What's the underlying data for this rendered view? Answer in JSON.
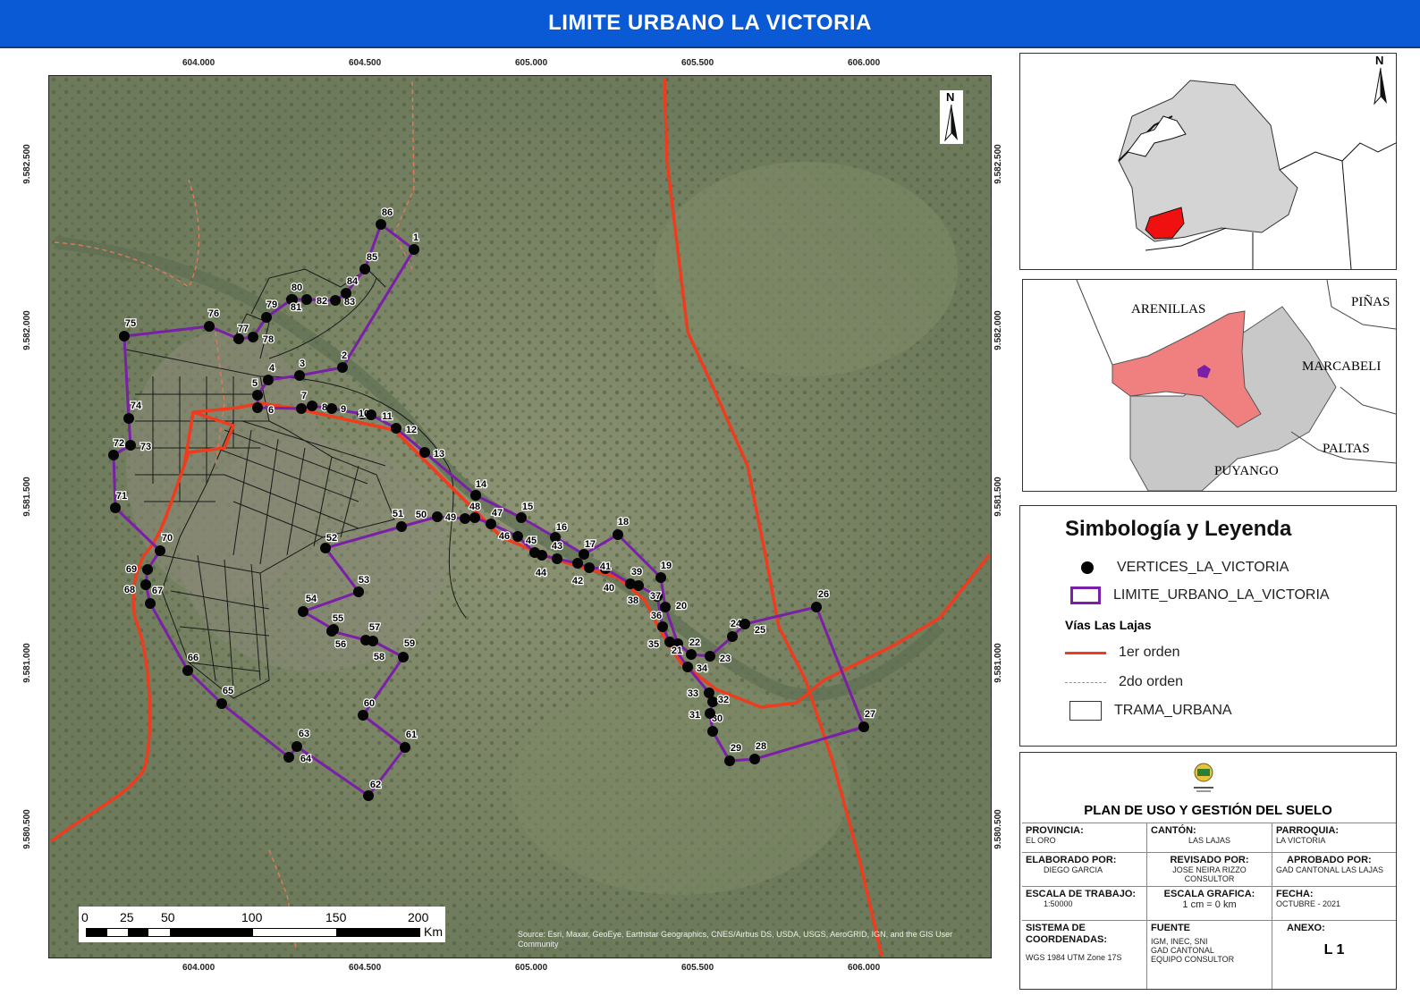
{
  "title": "LIMITE URBANO LA VICTORIA",
  "grid": {
    "x_labels": [
      "604.000",
      "604.500",
      "605.000",
      "605.500",
      "606.000"
    ],
    "y_labels": [
      "9.582.500",
      "9.582.000",
      "9.581.500",
      "9.581.000",
      "9.580.500"
    ]
  },
  "vertices": [
    "1",
    "2",
    "3",
    "4",
    "5",
    "6",
    "7",
    "8",
    "9",
    "10",
    "11",
    "12",
    "13",
    "14",
    "15",
    "16",
    "17",
    "18",
    "19",
    "20",
    "21",
    "22",
    "23",
    "24",
    "25",
    "26",
    "27",
    "28",
    "29",
    "30",
    "31",
    "32",
    "33",
    "34",
    "35",
    "36",
    "37",
    "38",
    "39",
    "40",
    "41",
    "42",
    "43",
    "44",
    "45",
    "46",
    "47",
    "48",
    "49",
    "50",
    "51",
    "52",
    "53",
    "54",
    "55",
    "56",
    "57",
    "58",
    "59",
    "60",
    "61",
    "62",
    "63",
    "64",
    "65",
    "66",
    "67",
    "68",
    "69",
    "70",
    "71",
    "72",
    "73",
    "74",
    "75",
    "76",
    "77",
    "78",
    "79",
    "80",
    "81",
    "82",
    "83",
    "84",
    "85",
    "86"
  ],
  "map_attribution": "Source: Esri, Maxar, GeoEye, Earthstar Geographics, CNES/Airbus DS, USDA, USGS, AeroGRID, IGN, and the GIS User Community",
  "scale_bar": {
    "ticks": [
      "0",
      "25",
      "50",
      "100",
      "150",
      "200"
    ],
    "unit": "Km"
  },
  "north_label": "N",
  "locator_labels": [
    "ARENILLAS",
    "PIÑAS",
    "MARCABELI",
    "PALTAS",
    "PUYANGO"
  ],
  "legend": {
    "title": "Simbología y Leyenda",
    "vertices": "VERTICES_LA_VICTORIA",
    "limit": "LIMITE_URBANO_LA_VICTORIA",
    "roads_title": "Vías Las Lajas",
    "road1": "1er orden",
    "road2": "2do orden",
    "urban": "TRAMA_URBANA"
  },
  "info": {
    "plan_title": "PLAN DE USO Y GESTIÓN DEL SUELO",
    "provincia_lbl": "PROVINCIA:",
    "provincia": "EL ORO",
    "canton_lbl": "CANTÓN:",
    "canton": "LAS LAJAS",
    "parroquia_lbl": "PARROQUIA:",
    "parroquia": "LA VICTORIA",
    "elaborado_lbl": "ELABORADO POR:",
    "elaborado": "DIEGO GARCIA",
    "revisado_lbl": "REVISADO POR:",
    "revisado1": "JOSE NEIRA RIZZO",
    "revisado2": "CONSULTOR",
    "aprobado_lbl": "APROBADO POR:",
    "aprobado": "GAD CANTONAL LAS LAJAS",
    "escala_trabajo_lbl": "ESCALA DE TRABAJO:",
    "escala_trabajo": "1:50000",
    "escala_grafica_lbl": "ESCALA GRAFICA:",
    "escala_grafica": "1 cm = 0 km",
    "fecha_lbl": "FECHA:",
    "fecha": "OCTUBRE - 2021",
    "sistema_lbl": "SISTEMA DE COORDENADAS:",
    "sistema": "WGS 1984 UTM Zone 17S",
    "fuente_lbl": "FUENTE",
    "fuente1": "IGM, INEC, SNI",
    "fuente2": "GAD CANTONAL",
    "fuente3": "EQUIPO CONSULTOR",
    "anexo_lbl": "ANEXO:",
    "anexo": "L 1"
  },
  "colors": {
    "title_bar": "#0a5ad6",
    "boundary": "#7a1fa8",
    "road_primary": "#ef3b1e",
    "road_secondary": "#e07a5a",
    "locator_highlight": "#f01010",
    "canton_highlight": "#f08080"
  }
}
